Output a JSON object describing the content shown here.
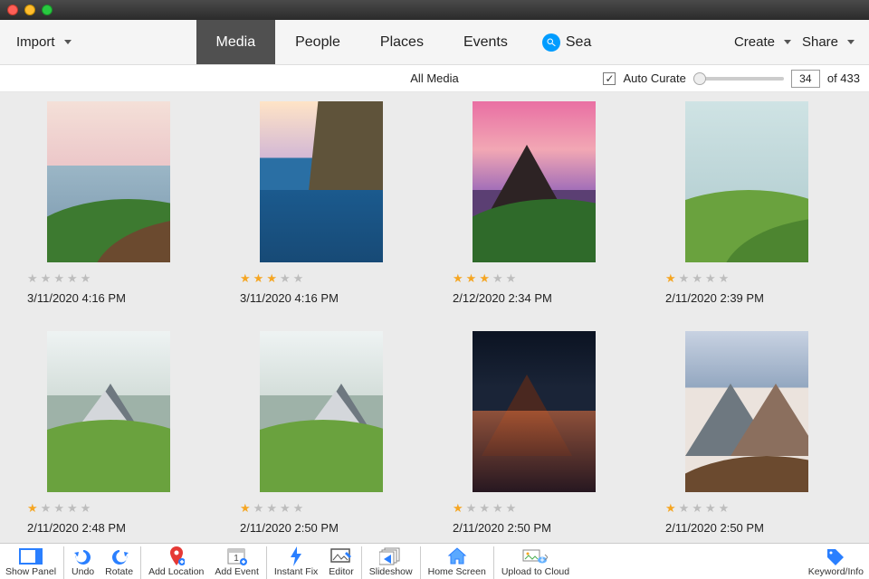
{
  "toolbar": {
    "import": "Import",
    "tabs": [
      "Media",
      "People",
      "Places",
      "Events"
    ],
    "activeTab": 0,
    "searchText": "Sea",
    "create": "Create",
    "share": "Share"
  },
  "filter": {
    "title": "All Media",
    "autoCurate": "Auto Curate",
    "autoCurateChecked": true,
    "count": "34",
    "total": "of 433"
  },
  "thumbs": [
    {
      "date": "3/11/2020 4:16 PM",
      "rating": 0,
      "style": "sky1"
    },
    {
      "date": "3/11/2020 4:16 PM",
      "rating": 3,
      "style": "sky2"
    },
    {
      "date": "2/12/2020 2:34 PM",
      "rating": 3,
      "style": "sky3"
    },
    {
      "date": "2/11/2020 2:39 PM",
      "rating": 1,
      "style": "sky4"
    },
    {
      "date": "2/11/2020 2:48 PM",
      "rating": 1,
      "style": "sky5"
    },
    {
      "date": "2/11/2020 2:50 PM",
      "rating": 1,
      "style": "sky6"
    },
    {
      "date": "2/11/2020 2:50 PM",
      "rating": 1,
      "style": "sky7"
    },
    {
      "date": "2/11/2020 2:50 PM",
      "rating": 1,
      "style": "sky8"
    }
  ],
  "dock": {
    "showPanel": "Show Panel",
    "undo": "Undo",
    "rotate": "Rotate",
    "addLocation": "Add Location",
    "addEvent": "Add Event",
    "instantFix": "Instant Fix",
    "editor": "Editor",
    "slideshow": "Slideshow",
    "homeScreen": "Home Screen",
    "uploadToCloud": "Upload to Cloud",
    "keywordInfo": "Keyword/Info"
  }
}
